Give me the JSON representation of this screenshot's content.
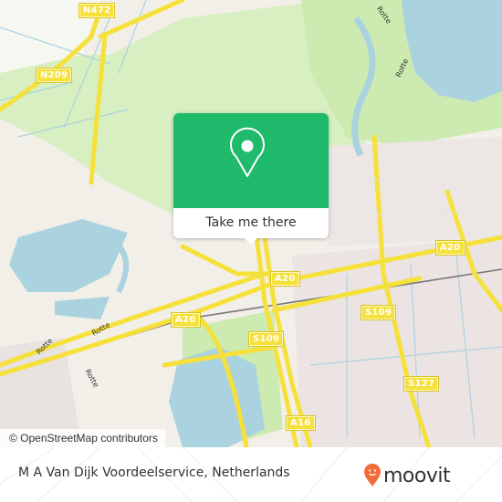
{
  "map": {
    "road_labels": [
      {
        "id": "n472",
        "text": "N472"
      },
      {
        "id": "n209",
        "text": "N209"
      },
      {
        "id": "a20-west",
        "text": "A20"
      },
      {
        "id": "a20-center",
        "text": "A20"
      },
      {
        "id": "a20-east",
        "text": "A20"
      },
      {
        "id": "s109-center",
        "text": "S109"
      },
      {
        "id": "s109-east",
        "text": "S109"
      },
      {
        "id": "s127",
        "text": "S127"
      },
      {
        "id": "a16",
        "text": "A16"
      }
    ],
    "water_labels": [
      {
        "id": "rotte-1",
        "text": "Rotte"
      },
      {
        "id": "rotte-2",
        "text": "Rotte"
      },
      {
        "id": "rotte-3",
        "text": "Rotte"
      },
      {
        "id": "rotte-4",
        "text": "Rotte"
      },
      {
        "id": "rotte-5",
        "text": "Rotte"
      }
    ],
    "attribution": "© OpenStreetMap contributors",
    "colors": {
      "water": "#aad3df",
      "green": "#cdebb0",
      "road": "#f6e03a",
      "land": "#f2efe9"
    }
  },
  "popup": {
    "icon": "map-pin-icon",
    "button_label": "Take me there",
    "color": "#1fba6b"
  },
  "footer": {
    "place_name": "M A Van Dijk Voordeelservice, Netherlands",
    "logo_text": "moovit",
    "logo_color": "#f26b3a"
  }
}
